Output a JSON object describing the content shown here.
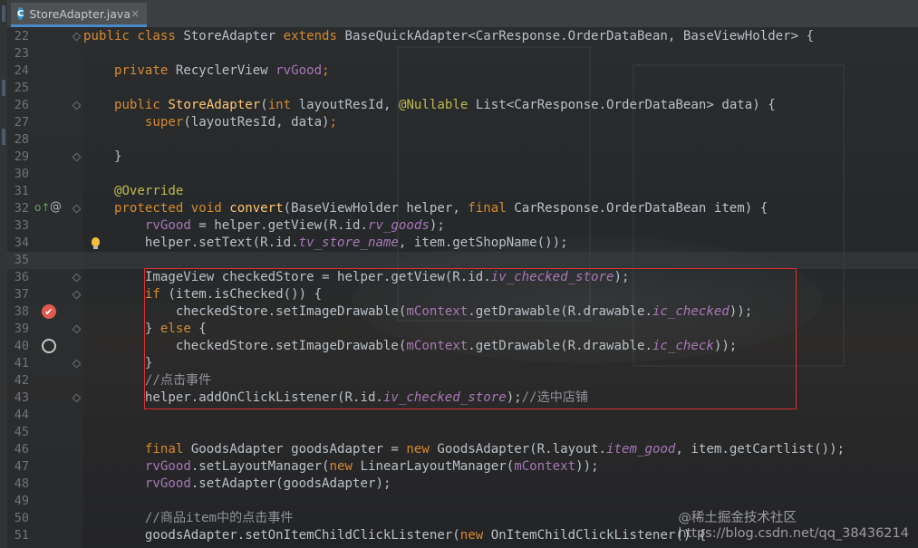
{
  "tab": {
    "icon_letter": "C",
    "filename": "StoreAdapter.java",
    "close_glyph": "×"
  },
  "gutter_markers": {
    "override_glyph": "o↑",
    "annotation_glyph": "@",
    "breakpoint_glyph": "✔"
  },
  "lines": [
    {
      "n": "22",
      "segs": [
        [
          "kw",
          "public class "
        ],
        [
          "",
          "StoreAdapter "
        ],
        [
          "kw",
          "extends "
        ],
        [
          "",
          "BaseQuickAdapter<CarResponse.OrderDataBean, BaseViewHolder> {"
        ]
      ]
    },
    {
      "n": "23",
      "segs": []
    },
    {
      "n": "24",
      "segs": [
        [
          "",
          "    "
        ],
        [
          "kw",
          "private "
        ],
        [
          "",
          "RecyclerView "
        ],
        [
          "fld",
          "rvGood"
        ],
        [
          "kw",
          ";"
        ]
      ]
    },
    {
      "n": "25",
      "segs": []
    },
    {
      "n": "26",
      "segs": [
        [
          "",
          "    "
        ],
        [
          "kw",
          "public "
        ],
        [
          "fn",
          "StoreAdapter"
        ],
        [
          "",
          "("
        ],
        [
          "kw",
          "int "
        ],
        [
          "",
          "layoutResId, "
        ],
        [
          "ann",
          "@Nullable "
        ],
        [
          "",
          "List<CarResponse.OrderDataBean> data) {"
        ]
      ]
    },
    {
      "n": "27",
      "segs": [
        [
          "",
          "        "
        ],
        [
          "kw",
          "super"
        ],
        [
          "",
          "(layoutResId, data)"
        ],
        [
          "kw",
          ";"
        ]
      ]
    },
    {
      "n": "28",
      "segs": []
    },
    {
      "n": "29",
      "segs": [
        [
          "",
          "    }"
        ]
      ]
    },
    {
      "n": "30",
      "segs": []
    },
    {
      "n": "31",
      "segs": [
        [
          "",
          "    "
        ],
        [
          "ann",
          "@Override"
        ]
      ]
    },
    {
      "n": "32",
      "segs": [
        [
          "",
          "    "
        ],
        [
          "kw",
          "protected void "
        ],
        [
          "fn",
          "convert"
        ],
        [
          "",
          "(BaseViewHolder helper, "
        ],
        [
          "kw",
          "final "
        ],
        [
          "",
          "CarResponse.OrderDataBean item) {"
        ]
      ]
    },
    {
      "n": "33",
      "segs": [
        [
          "",
          "        "
        ],
        [
          "fld",
          "rvGood "
        ],
        [
          "",
          "= helper.getView(R.id."
        ],
        [
          "fld ital",
          "rv_goods"
        ],
        [
          "",
          "); "
        ]
      ]
    },
    {
      "n": "34",
      "segs": [
        [
          "",
          "        helper.setText(R.id."
        ],
        [
          "fld ital",
          "tv_store_name"
        ],
        [
          "",
          ", item.getShopName());"
        ]
      ]
    },
    {
      "n": "35",
      "segs": [],
      "current": true
    },
    {
      "n": "36",
      "segs": [
        [
          "",
          "        ImageView checkedStore = helper.getView(R.id."
        ],
        [
          "fld ital",
          "iv_checked_store"
        ],
        [
          "",
          ");"
        ]
      ]
    },
    {
      "n": "37",
      "segs": [
        [
          "",
          "        "
        ],
        [
          "kw",
          "if "
        ],
        [
          "",
          "(item.isChecked()) {"
        ]
      ]
    },
    {
      "n": "38",
      "segs": [
        [
          "",
          "            checkedStore.setImageDrawable("
        ],
        [
          "fld",
          "mContext"
        ],
        [
          "",
          ".getDrawable(R.drawable."
        ],
        [
          "fld ital",
          "ic_checked"
        ],
        [
          "",
          "));"
        ]
      ]
    },
    {
      "n": "39",
      "segs": [
        [
          "",
          "        } "
        ],
        [
          "kw",
          "else "
        ],
        [
          "",
          "{"
        ]
      ]
    },
    {
      "n": "40",
      "segs": [
        [
          "",
          "            checkedStore.setImageDrawable("
        ],
        [
          "fld",
          "mContext"
        ],
        [
          "",
          ".getDrawable(R.drawable."
        ],
        [
          "fld ital",
          "ic_check"
        ],
        [
          "",
          "));"
        ]
      ]
    },
    {
      "n": "41",
      "segs": [
        [
          "",
          "        }"
        ]
      ]
    },
    {
      "n": "42",
      "segs": [
        [
          "",
          "        "
        ],
        [
          "cmt",
          "//点击事件"
        ]
      ]
    },
    {
      "n": "43",
      "segs": [
        [
          "",
          "        helper.addOnClickListener(R.id."
        ],
        [
          "fld ital",
          "iv_checked_store"
        ],
        [
          "",
          ");"
        ],
        [
          "cmt",
          "//选中店铺"
        ]
      ]
    },
    {
      "n": "44",
      "segs": []
    },
    {
      "n": "45",
      "segs": []
    },
    {
      "n": "46",
      "segs": [
        [
          "",
          "        "
        ],
        [
          "kw",
          "final "
        ],
        [
          "",
          "GoodsAdapter goodsAdapter = "
        ],
        [
          "kw",
          "new "
        ],
        [
          "",
          "GoodsAdapter(R.layout."
        ],
        [
          "fld ital",
          "item_good"
        ],
        [
          "",
          ", item.getCartlist());"
        ]
      ]
    },
    {
      "n": "47",
      "segs": [
        [
          "",
          "        "
        ],
        [
          "fld",
          "rvGood"
        ],
        [
          "",
          ".setLayoutManager("
        ],
        [
          "kw",
          "new "
        ],
        [
          "",
          "LinearLayoutManager("
        ],
        [
          "fld",
          "mContext"
        ],
        [
          "",
          "));"
        ]
      ]
    },
    {
      "n": "48",
      "segs": [
        [
          "",
          "        "
        ],
        [
          "fld",
          "rvGood"
        ],
        [
          "",
          ".setAdapter(goodsAdapter);"
        ]
      ]
    },
    {
      "n": "49",
      "segs": []
    },
    {
      "n": "50",
      "segs": [
        [
          "",
          "        "
        ],
        [
          "cmt",
          "//商品item中的点击事件"
        ]
      ]
    },
    {
      "n": "51",
      "segs": [
        [
          "",
          "        goodsAdapter.setOnItemChildClickListener("
        ],
        [
          "kw",
          "new "
        ],
        [
          "",
          "OnItemChildClickListener() {"
        ]
      ]
    }
  ],
  "watermark": "https://blog.csdn.net/qq_38436214",
  "watermark_cn": "@稀土掘金技术社区",
  "colors": {
    "keyword": "#d6892f",
    "function": "#ffc66d",
    "field": "#a678b4",
    "annotation": "#c0b94a",
    "comment": "#8f9299",
    "highlight_box": "#e02e2e"
  }
}
